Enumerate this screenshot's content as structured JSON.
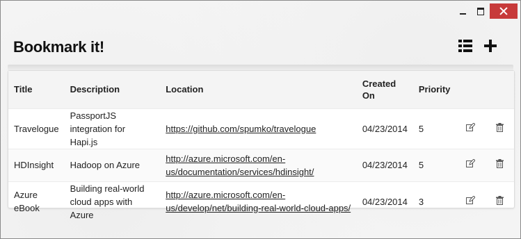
{
  "app": {
    "title": "Bookmark it!"
  },
  "toolbar": {
    "list_icon": "list-icon",
    "add_icon": "plus-icon"
  },
  "table": {
    "headers": {
      "title": "Title",
      "description": "Description",
      "location": "Location",
      "created": "Created On",
      "priority": "Priority"
    },
    "rows": [
      {
        "title": "Travelogue",
        "description": "PassportJS integration for Hapi.js",
        "location": "https://github.com/spumko/travelogue",
        "created": "04/23/2014",
        "priority": "5"
      },
      {
        "title": "HDInsight",
        "description": "Hadoop on Azure",
        "location": "http://azure.microsoft.com/en-us/documentation/services/hdinsight/",
        "created": "04/23/2014",
        "priority": "5"
      },
      {
        "title": "Azure eBook",
        "description": "Building real-world cloud apps with Azure",
        "location": "http://azure.microsoft.com/en-us/develop/net/building-real-world-cloud-apps/",
        "created": "04/23/2014",
        "priority": "3"
      }
    ]
  },
  "colors": {
    "close_button": "#c73a3a",
    "header_bg": "#f4f4f4"
  }
}
